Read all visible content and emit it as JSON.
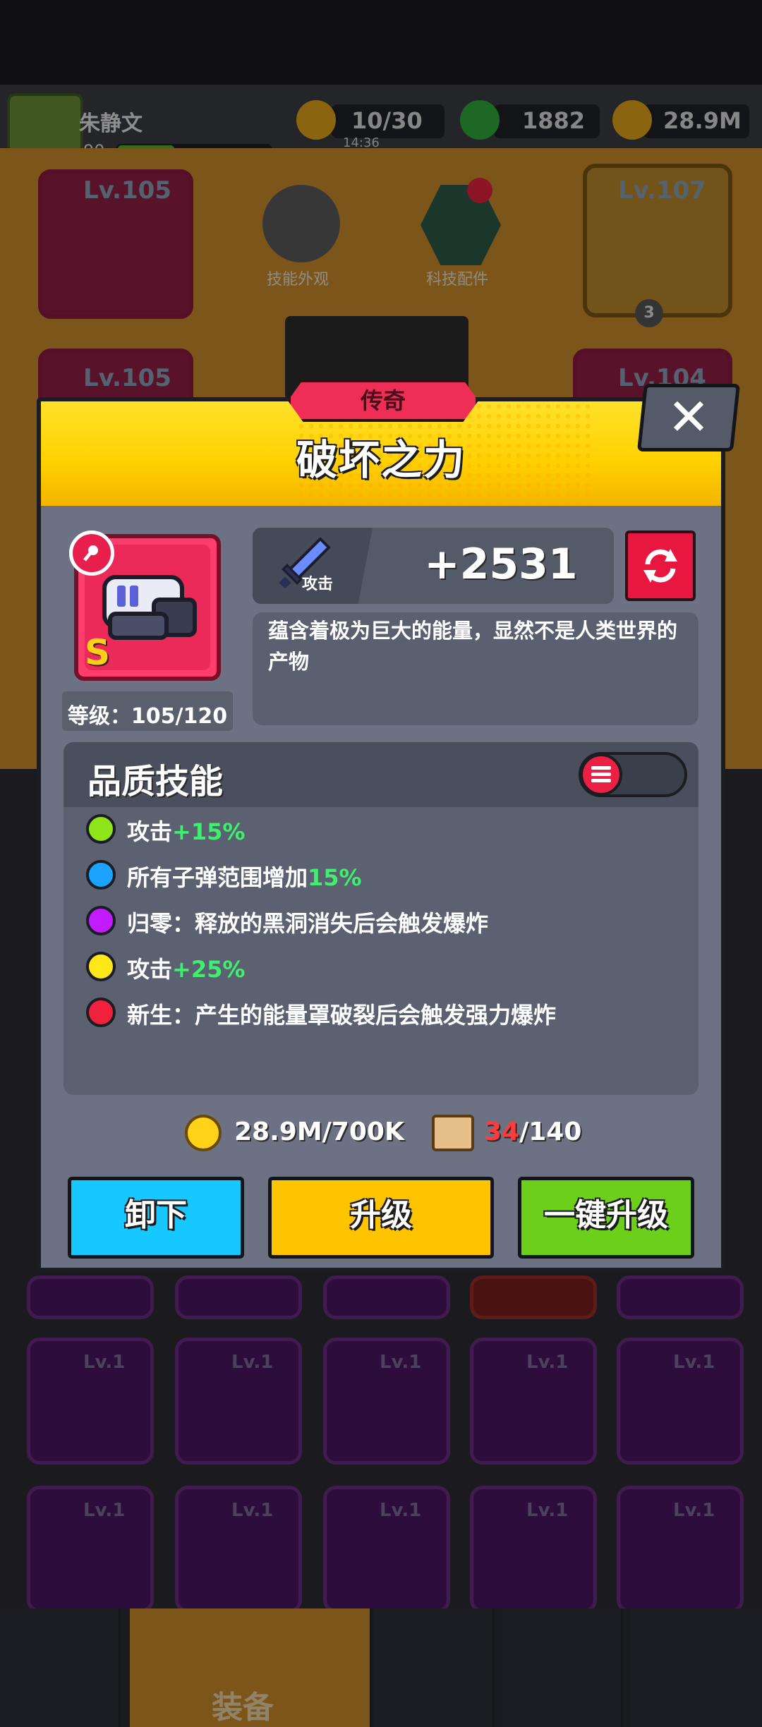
{
  "hud": {
    "player_name": "朱静文",
    "player_level": "90",
    "energy": "10/30",
    "energy_timer": "14:36",
    "gems": "1882",
    "coins": "28.9M"
  },
  "background": {
    "tabs": [
      "技能外观",
      "科技配件"
    ],
    "cards_top": [
      "Lv.105",
      "Lv.107"
    ],
    "cards_second": [
      "Lv.105",
      "Lv.104"
    ],
    "card_count_badge": "3",
    "grid_levels": [
      "Lv.1",
      "Lv.1",
      "Lv.1",
      "Lv.1",
      "Lv.1"
    ],
    "nav_active_label": "装备"
  },
  "modal": {
    "rarity": "传奇",
    "title": "破坏之力",
    "item_grade": "S",
    "level_text": "等级：105/120",
    "stat_label": "攻击",
    "stat_value": "+2531",
    "description": "蕴含着极为巨大的能量，显然不是人类世界的产物",
    "skills_title": "品质技能",
    "skills": [
      {
        "color": "#8fe41a",
        "text": "攻击",
        "highlight": "+15%"
      },
      {
        "color": "#1aa3ff",
        "text": "所有子弹范围增加",
        "highlight": "15%"
      },
      {
        "color": "#c21bff",
        "text": "归零：释放的黑洞消失后会触发爆炸",
        "highlight": ""
      },
      {
        "color": "#ffe81a",
        "text": "攻击",
        "highlight": "+25%"
      },
      {
        "color": "#f0213d",
        "text": "新生：产生的能量罩破裂后会触发强力爆炸",
        "highlight": ""
      }
    ],
    "gold_cost": "28.9M/700K",
    "scroll_have": "34",
    "scroll_need": "/140",
    "buttons": {
      "unequip": "卸下",
      "upgrade": "升级",
      "upgrade_all": "一键升级"
    },
    "colors": {
      "unequip": "#16c8ff",
      "upgrade": "#ffc400",
      "upgrade_all": "#6cd01a",
      "header": "#ffd000",
      "rarity_tag": "#ef2e55"
    }
  }
}
